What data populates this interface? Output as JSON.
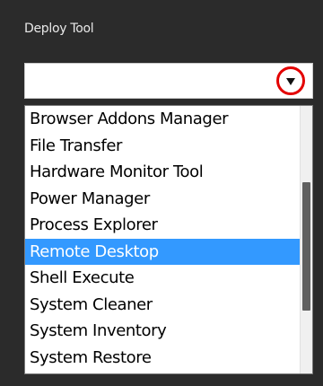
{
  "panel": {
    "label": "Deploy Tool"
  },
  "select": {
    "value": "",
    "arrow_icon": "chevron-down-icon",
    "highlight_color": "#e30000"
  },
  "dropdown": {
    "items": [
      "Browser Addons Manager",
      "File Transfer",
      "Hardware Monitor Tool",
      "Power Manager",
      "Process Explorer",
      "Remote Desktop",
      "Shell Execute",
      "System Cleaner",
      "System Inventory",
      "System Restore"
    ],
    "selected_index": 5,
    "selected_color": "#3399ff",
    "scroll_position": 0.55,
    "visible_fraction": 0.8
  }
}
